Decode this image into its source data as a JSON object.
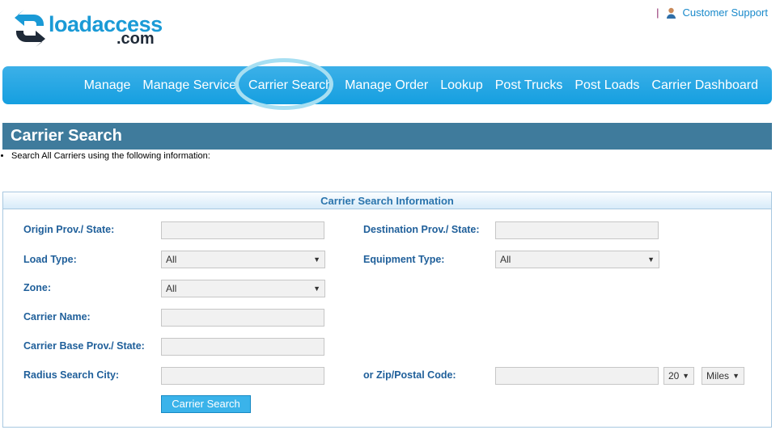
{
  "logo": {
    "word": "loadaccess",
    "tld": ".com"
  },
  "top_links": {
    "separator": "|",
    "support_label": "Customer Support"
  },
  "nav": {
    "items": [
      {
        "label": "Manage"
      },
      {
        "label": "Manage Service"
      },
      {
        "label": "Carrier Search"
      },
      {
        "label": "Manage Order"
      },
      {
        "label": "Lookup"
      },
      {
        "label": "Post Trucks"
      },
      {
        "label": "Post Loads"
      },
      {
        "label": "Carrier Dashboard"
      }
    ],
    "active": "Carrier Search"
  },
  "page": {
    "title": "Carrier Search",
    "intro": "Search All Carriers using the following information:"
  },
  "form": {
    "panel_title": "Carrier Search Information",
    "origin_label": "Origin Prov./ State:",
    "origin_value": "",
    "destination_label": "Destination Prov./ State:",
    "destination_value": "",
    "load_type_label": "Load Type:",
    "load_type_value": "All",
    "equipment_type_label": "Equipment Type:",
    "equipment_type_value": "All",
    "zone_label": "Zone:",
    "zone_value": "All",
    "carrier_name_label": "Carrier Name:",
    "carrier_name_value": "",
    "carrier_base_label": "Carrier Base Prov./ State:",
    "carrier_base_value": "",
    "radius_city_label": "Radius Search City:",
    "radius_city_value": "",
    "zip_label": "or Zip/Postal Code:",
    "zip_value": "",
    "radius_value": "20",
    "radius_unit": "Miles",
    "submit_label": "Carrier Search"
  },
  "colors": {
    "nav_blue": "#159fe0",
    "title_bar": "#3f7b9c",
    "label_blue": "#1f5f9a",
    "button_blue": "#3ab3ea"
  }
}
